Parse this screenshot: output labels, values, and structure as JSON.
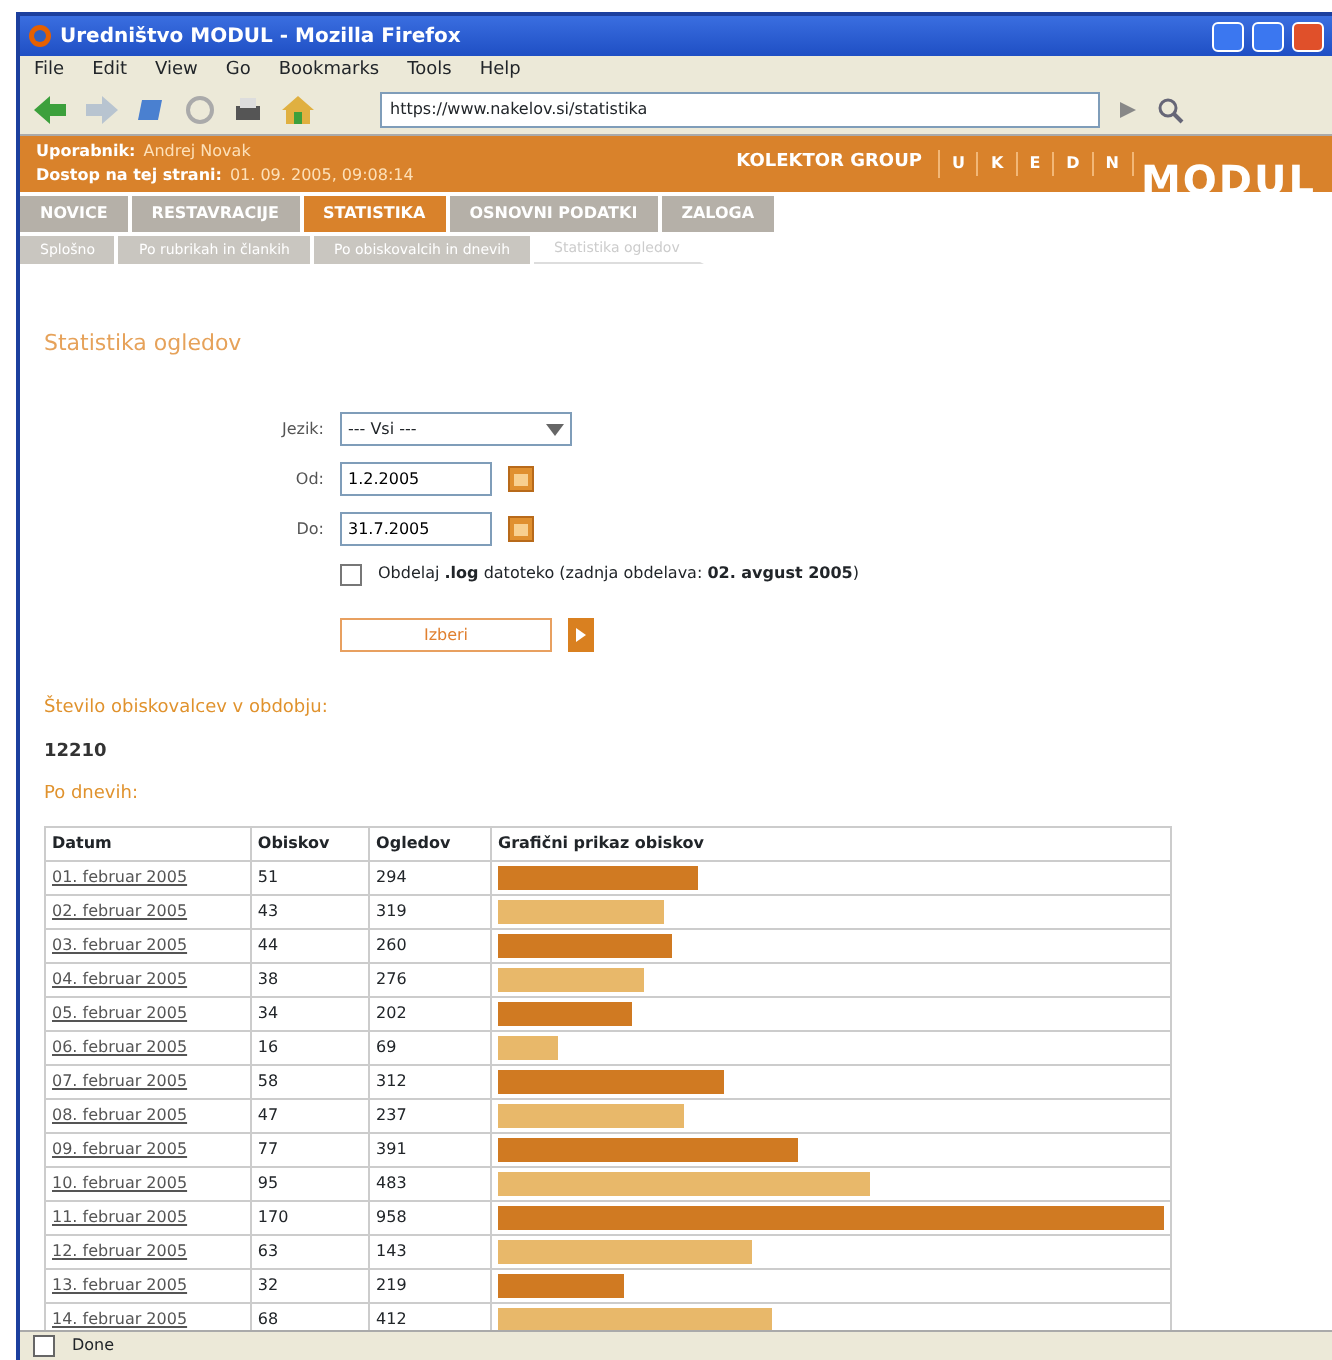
{
  "window": {
    "title": "Uredništvo MODUL - Mozilla Firefox"
  },
  "menu": [
    "File",
    "Edit",
    "View",
    "Go",
    "Bookmarks",
    "Tools",
    "Help"
  ],
  "address": "https://www.nakelov.si/statistika",
  "header": {
    "user_label": "Uporabnik:",
    "user": "Andrej Novak",
    "access_label": "Dostop na tej strani:",
    "access": "01. 09. 2005, 09:08:14",
    "group": "KOLEKTOR GROUP",
    "letters": [
      "U",
      "K",
      "E",
      "D",
      "N"
    ],
    "logo": "MODUL"
  },
  "tabs": [
    {
      "label": "NOVICE",
      "selected": false
    },
    {
      "label": "RESTAVRACIJE",
      "selected": false
    },
    {
      "label": "STATISTIKA",
      "selected": true
    },
    {
      "label": "OSNOVNI PODATKI",
      "selected": false
    },
    {
      "label": "ZALOGA",
      "selected": false
    }
  ],
  "subtabs": [
    {
      "label": "Splošno",
      "selected": false
    },
    {
      "label": "Po rubrikah in člankih",
      "selected": false
    },
    {
      "label": "Po obiskovalcih in dnevih",
      "selected": false
    },
    {
      "label": "Statistika ogledov",
      "selected": true
    }
  ],
  "heading": "Statistika ogledov",
  "form": {
    "language_label": "Jezik:",
    "language": "--- Vsi ---",
    "from_label": "Od:",
    "from": "1.2.2005",
    "to_label": "Do:",
    "to": "31.7.2005",
    "log_checked": false,
    "log_text": "Obdelaj **.log** datoteko (zadnja obdelava: **02. avgust 2005**)",
    "submit": "Izberi"
  },
  "visitors_label": "Število obiskovalcev v obdobju:",
  "visitors": "12210",
  "by_day": "Po dnevih:",
  "table": {
    "columns": [
      "Datum",
      "Obiskov",
      "Ogledov",
      "Grafični prikaz obiskov"
    ],
    "rows": [
      {
        "date": "01. februar 2005",
        "visits": "51",
        "views": "294",
        "level": 0.3
      },
      {
        "date": "02. februar 2005",
        "visits": "43",
        "views": "319",
        "level": 0.25
      },
      {
        "date": "03. februar 2005",
        "visits": "44",
        "views": "260",
        "level": 0.26
      },
      {
        "date": "04. februar 2005",
        "visits": "38",
        "views": "276",
        "level": 0.22
      },
      {
        "date": "05. februar 2005",
        "visits": "34",
        "views": "202",
        "level": 0.2
      },
      {
        "date": "06. februar 2005",
        "visits": "16",
        "views": "69",
        "level": 0.09
      },
      {
        "date": "07. februar 2005",
        "visits": "58",
        "views": "312",
        "level": 0.34
      },
      {
        "date": "08. februar 2005",
        "visits": "47",
        "views": "237",
        "level": 0.28
      },
      {
        "date": "09. februar 2005",
        "visits": "77",
        "views": "391",
        "level": 0.45
      },
      {
        "date": "10. februar 2005",
        "visits": "95",
        "views": "483",
        "level": 0.56
      },
      {
        "date": "11. februar 2005",
        "visits": "170",
        "views": "958",
        "level": 1.0
      },
      {
        "date": "12. februar 2005",
        "visits": "63",
        "views": "143",
        "level": 0.38
      },
      {
        "date": "13. februar 2005",
        "visits": "32",
        "views": "219",
        "level": 0.19
      },
      {
        "date": "14. februar 2005",
        "visits": "68",
        "views": "412",
        "level": 0.41
      }
    ]
  },
  "status": "Done"
}
